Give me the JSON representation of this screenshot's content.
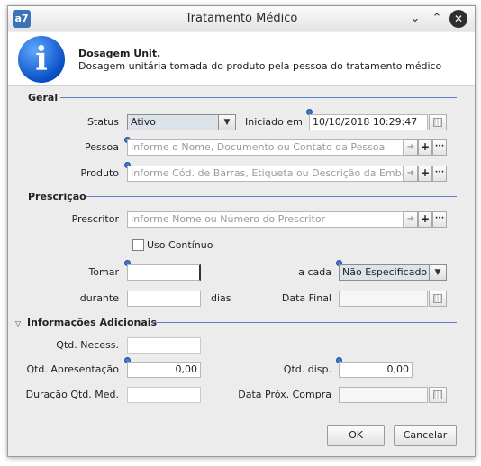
{
  "window": {
    "title": "Tratamento Médico",
    "app_icon_text": "a7",
    "controls": {
      "minimize": "⌄",
      "maximize": "⌃",
      "close": "✕"
    }
  },
  "header": {
    "icon": "info-icon",
    "icon_glyph": "i",
    "title": "Dosagem Unit.",
    "subtitle": "Dosagem unitária tomada do produto pela pessoa do tratamento médico"
  },
  "geral": {
    "section_label": "Geral",
    "status_label": "Status",
    "status_value": "Ativo",
    "iniciado_label": "Iniciado em",
    "iniciado_value": "10/10/2018 10:29:47",
    "pessoa_label": "Pessoa",
    "pessoa_placeholder": "Informe o Nome, Documento ou Contato da Pessoa",
    "produto_label": "Produto",
    "produto_placeholder": "Informe Cód. de Barras, Etiqueta ou Descrição da Embalagem"
  },
  "prescricao": {
    "section_label": "Prescrição",
    "prescritor_label": "Prescritor",
    "prescritor_placeholder": "Informe Nome ou Número do Prescritor",
    "uso_continuo_label": "Uso Contínuo",
    "uso_continuo_checked": false,
    "tomar_label": "Tomar",
    "tomar_value": "",
    "a_cada_label": "a cada",
    "a_cada_value": "Não Especificado",
    "durante_label": "durante",
    "durante_value": "",
    "dias_label": "dias",
    "data_final_label": "Data Final",
    "data_final_value": ""
  },
  "info_adicionais": {
    "section_label": "Informações Adicionais",
    "qtd_necess_label": "Qtd. Necess.",
    "qtd_necess_value": "",
    "qtd_apresentacao_label": "Qtd. Apresentação",
    "qtd_apresentacao_value": "0,00",
    "qtd_disp_label": "Qtd. disp.",
    "qtd_disp_value": "0,00",
    "duracao_label": "Duração Qtd. Med.",
    "duracao_value": "",
    "data_prox_compra_label": "Data Próx. Compra",
    "data_prox_compra_value": ""
  },
  "buttons": {
    "ok": "OK",
    "cancelar": "Cancelar",
    "add_glyph": "+",
    "more_glyph": "···",
    "arrow_glyph": "➜",
    "dropdown_glyph": "▼",
    "collapse_glyph": "▽"
  },
  "colors": {
    "section_line": "#5f7ec2",
    "required_dot": "#3e78d6",
    "info_icon": "#0a4fc4"
  }
}
